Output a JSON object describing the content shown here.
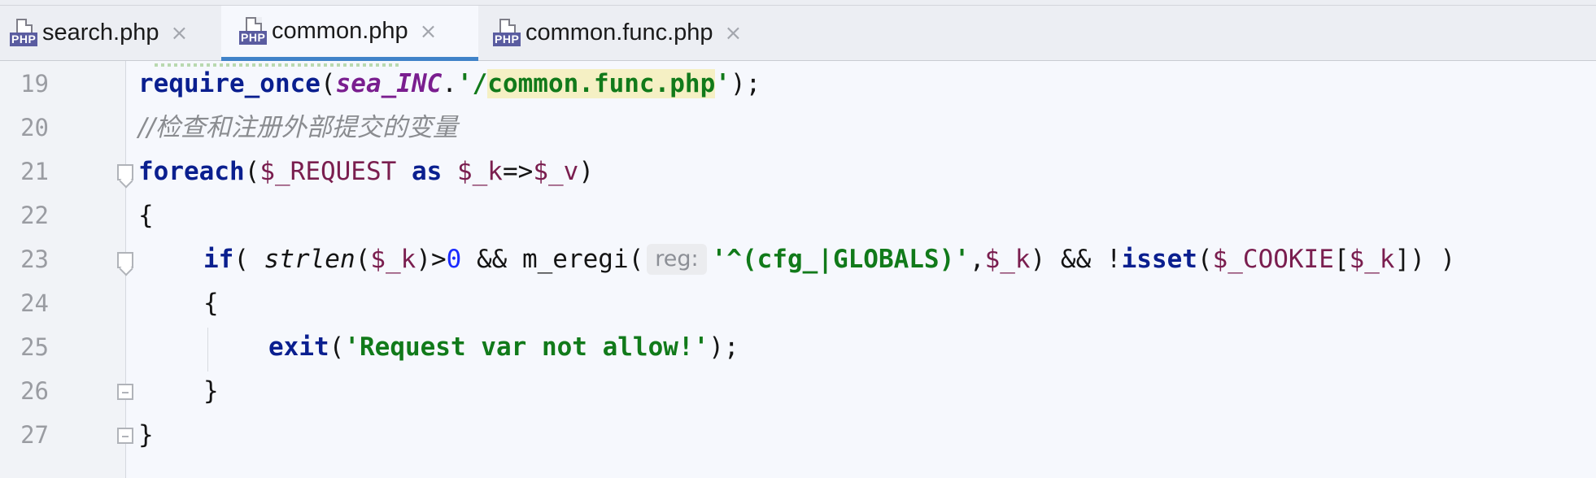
{
  "tabs": [
    {
      "title": "search.php",
      "badge": "PHP",
      "close": "×"
    },
    {
      "title": "common.php",
      "badge": "PHP",
      "close": "×"
    },
    {
      "title": "common.func.php",
      "badge": "PHP",
      "close": "×"
    }
  ],
  "line_numbers": [
    "19",
    "20",
    "21",
    "22",
    "23",
    "24",
    "25",
    "26",
    "27"
  ],
  "code": {
    "l19": {
      "fn": "require_once",
      "p1": "(",
      "const": "sea_INC",
      "dot": ".",
      "s1": "'/",
      "s2": "common.func.php",
      "s3": "'",
      "end": ");"
    },
    "l20": {
      "comment": "//检查和注册外部提交的变量"
    },
    "l21": {
      "kw": "foreach",
      "p1": "(",
      "v1": "$_REQUEST",
      "sp": " ",
      "as": "as",
      "sp2": " ",
      "v2": "$_k",
      "arrow": "=>",
      "v3": "$_v",
      "end": ")"
    },
    "l22": {
      "text": "{"
    },
    "l23": {
      "kw": "if",
      "p1": "( ",
      "fn": "strlen",
      "p2": "(",
      "v1": "$_k",
      "p3": ")>",
      "num": "0",
      "p4": " && m_eregi(",
      "hint": "reg:",
      "str": "'^(cfg_|GLOBALS)'",
      "p5": ",",
      "v2": "$_k",
      "p6": ") && !",
      "isset": "isset",
      "p7": "(",
      "v3": "$_COOKIE",
      "p8": "[",
      "v4": "$_k",
      "end": "]) )"
    },
    "l24": {
      "text": "{"
    },
    "l25": {
      "kw": "exit",
      "p1": "(",
      "str": "'Request var not allow!'",
      "end": ");"
    },
    "l26": {
      "text": "}"
    },
    "l27": {
      "text": "}"
    }
  }
}
